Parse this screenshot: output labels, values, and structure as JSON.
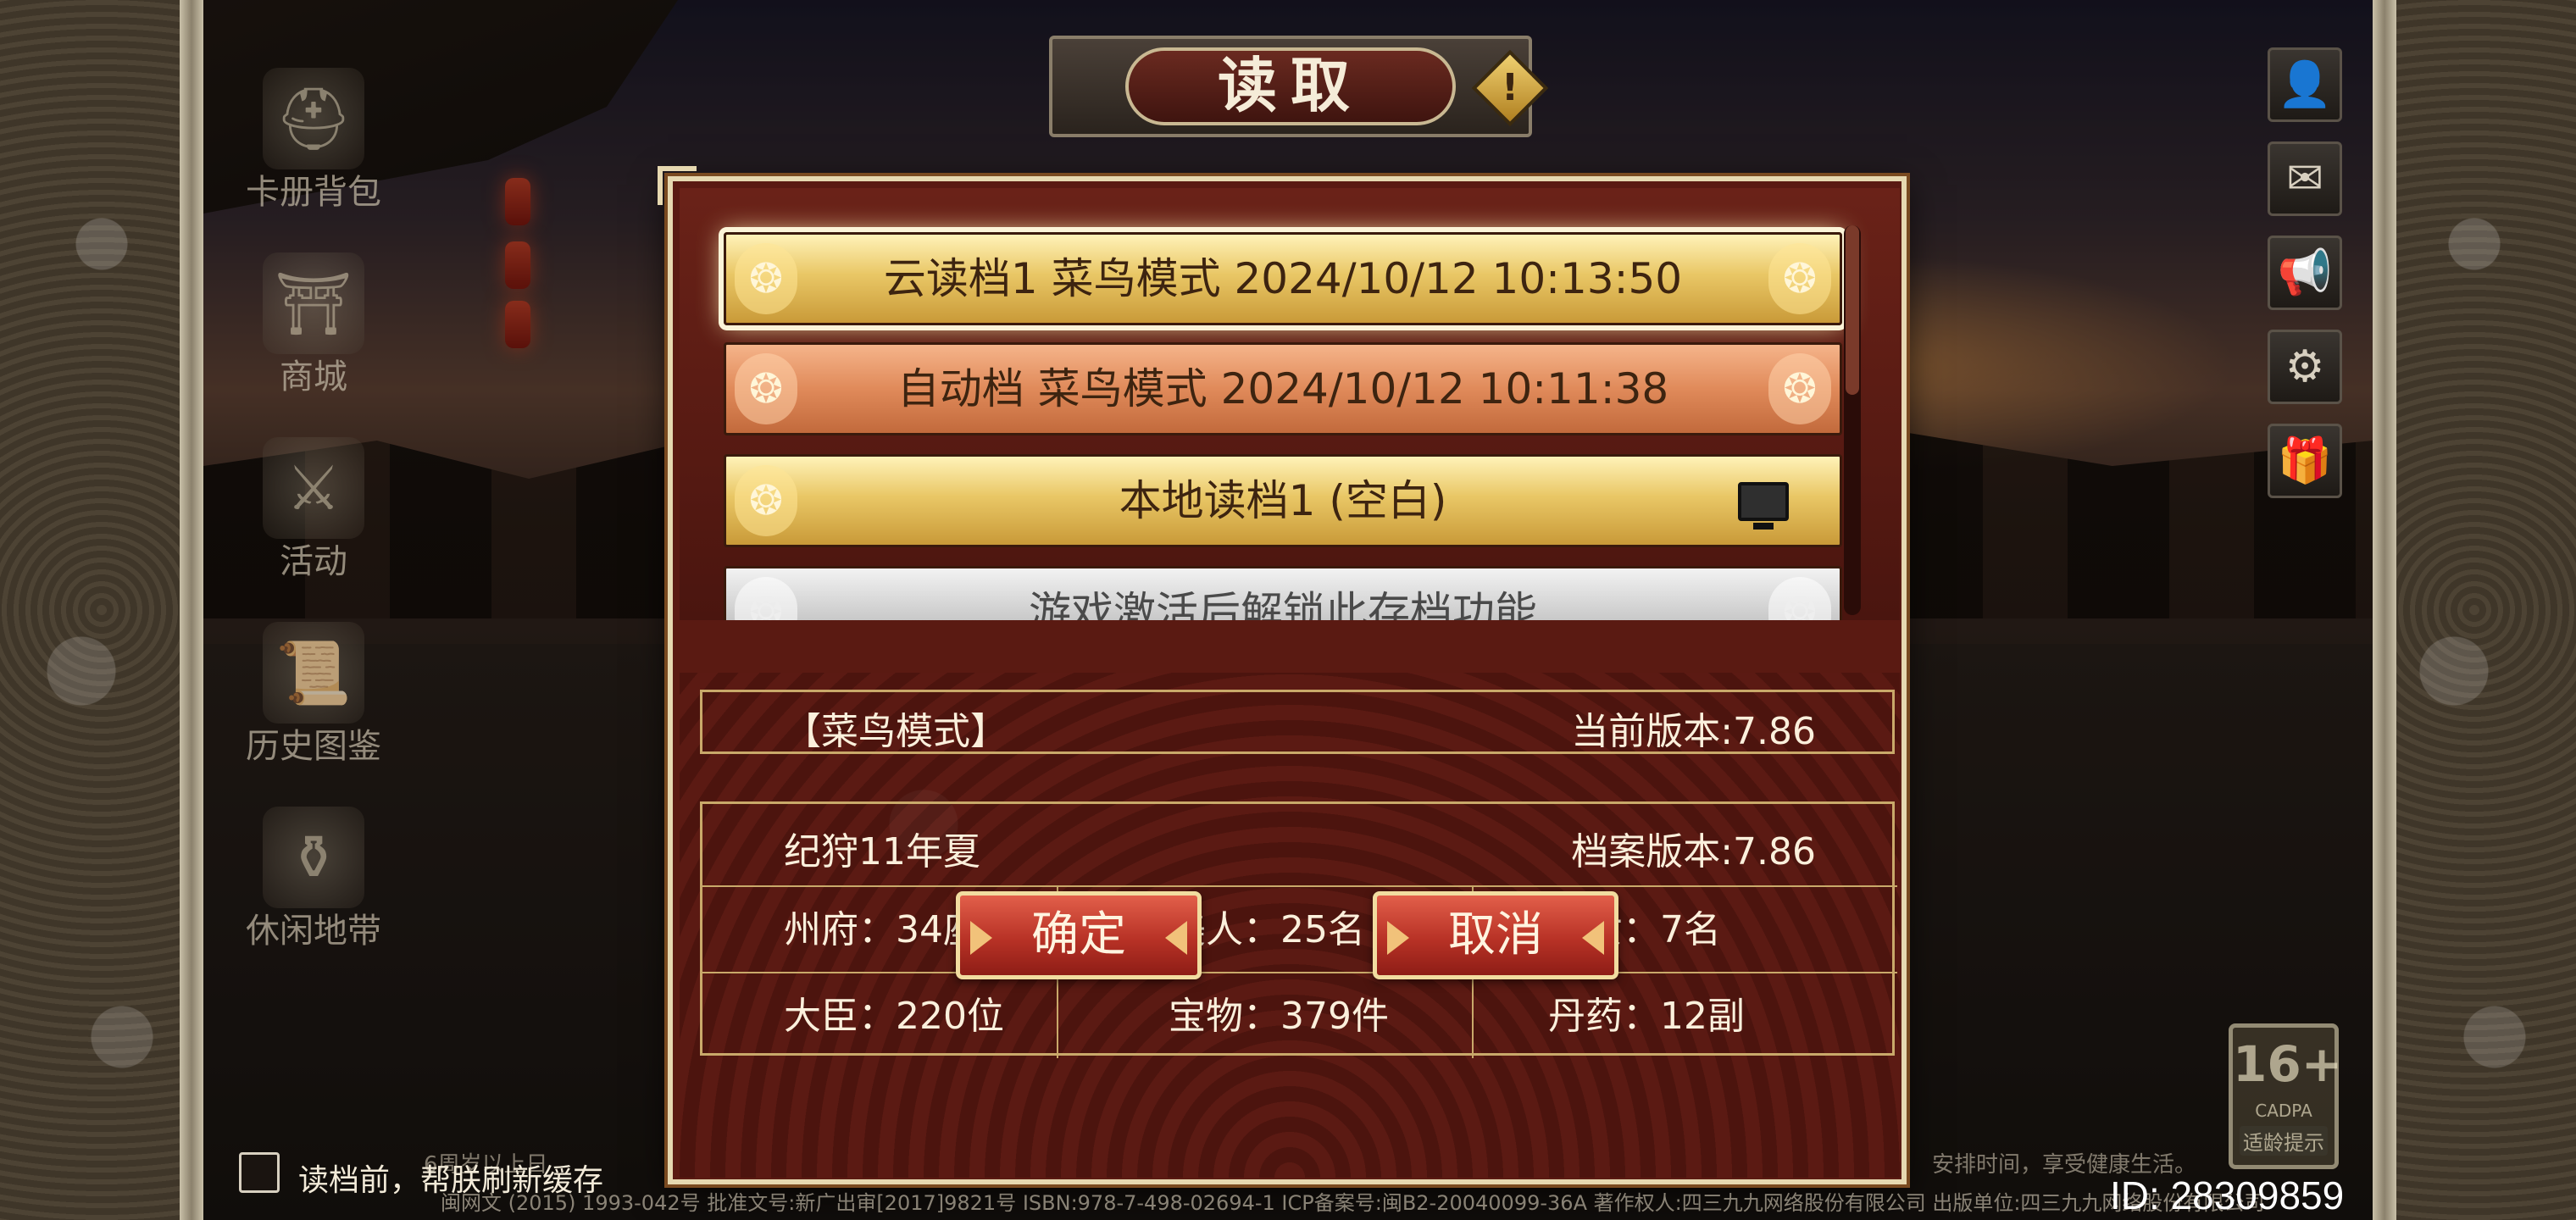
{
  "title": "读取",
  "left_menu": [
    {
      "label": "卡册背包",
      "icon": "helmet-icon"
    },
    {
      "label": "商城",
      "icon": "shop-icon"
    },
    {
      "label": "活动",
      "icon": "sword-icon"
    },
    {
      "label": "历史图鉴",
      "icon": "scroll-icon"
    },
    {
      "label": "休闲地带",
      "icon": "cauldron-icon"
    }
  ],
  "right_icons": [
    {
      "name": "profile-icon",
      "glyph": "👤"
    },
    {
      "name": "mail-icon",
      "glyph": "✉"
    },
    {
      "name": "horn-icon",
      "glyph": "📢"
    },
    {
      "name": "settings-icon",
      "glyph": "⚙"
    },
    {
      "name": "gift-icon",
      "glyph": "🎁"
    }
  ],
  "save_slots": [
    {
      "label": "云读档1  菜鸟模式  2024/10/12 10:13:50",
      "style": "gold",
      "selected": true
    },
    {
      "label": "自动档  菜鸟模式  2024/10/12 10:11:38",
      "style": "copper",
      "selected": false
    },
    {
      "label": "本地读档1   (空白)",
      "style": "gold",
      "selected": false,
      "icon": "computer-icon"
    },
    {
      "label": "游戏激活后解锁此存档功能",
      "style": "silver",
      "selected": false
    }
  ],
  "info": {
    "mode": "【菜鸟模式】",
    "current_version": "当前版本:7.86",
    "era": "纪狩11年夏",
    "save_version": "档案版本:7.86",
    "stats": [
      [
        "州府：34座",
        "美人：25名",
        "子女：7名"
      ],
      [
        "大臣：220位",
        "宝物：379件",
        "丹药：12副"
      ]
    ]
  },
  "buttons": {
    "confirm": "确定",
    "cancel": "取消"
  },
  "refresh_checkbox": {
    "label": "读档前，帮朕刷新缓存",
    "checked": false
  },
  "health_tip_left": "6周岁以上日",
  "health_tip_right": "安排时间，享受健康生活。",
  "copyright": "闽网文 (2015) 1993-042号  批准文号:新广出审[2017]9821号  ISBN:978-7-498-02694-1 ICP备案号:闽B2-20040099-36A 著作权人:四三九九网络股份有限公司 出版单位:四三九九网络股份有限公司",
  "age_rating": {
    "age": "16+",
    "org": "CADPA",
    "tip": "适龄提示"
  },
  "user_id": "ID: 28309859",
  "colors": {
    "dialog_red": "#5a1a12",
    "gold": "#e9c766",
    "copper": "#e08a5a",
    "border_cream": "#e6d8b0"
  }
}
